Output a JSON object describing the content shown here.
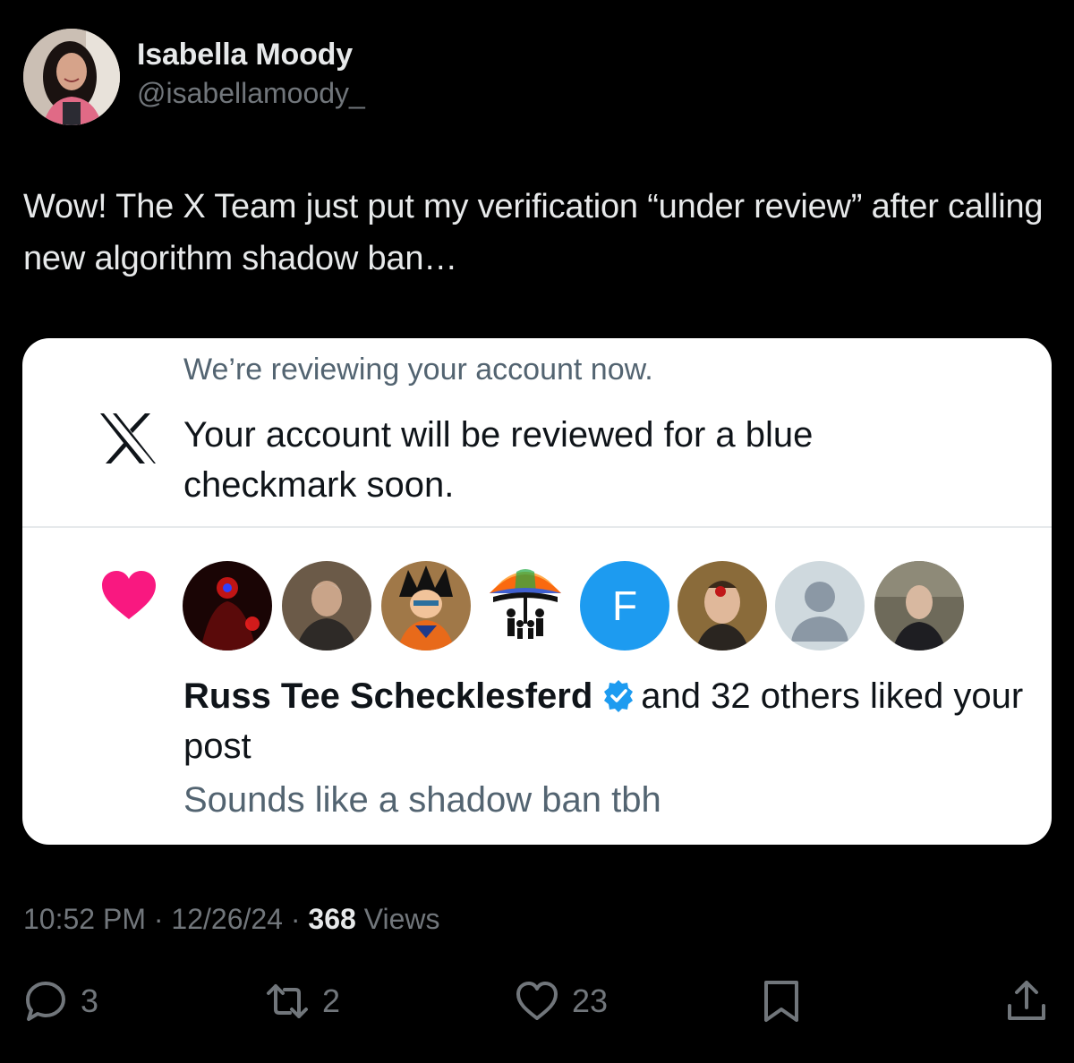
{
  "author": {
    "name": "Isabella Moody",
    "handle": "@isabellamoody_",
    "avatar_icon": "profile-photo"
  },
  "tweet": {
    "text": "Wow! The X Team just put my verification “under review” after calling new algorithm shadow ban…"
  },
  "embedded": {
    "review_title": "We’re reviewing your account now.",
    "review_body": "Your account will be reviewed for a blue checkmark soon.",
    "like_notification": {
      "liker_name": "Russ Tee Schecklesferd",
      "rest": "and 32 others liked your post",
      "reply_preview": "Sounds like a shadow ban tbh",
      "avatars": [
        {
          "icon": "dark-red-figure-avatar"
        },
        {
          "icon": "older-man-avatar"
        },
        {
          "icon": "anime-character-avatar"
        },
        {
          "icon": "umbrella-family-avatar"
        },
        {
          "icon": "letter-avatar",
          "letter": "F"
        },
        {
          "icon": "bloody-face-avatar"
        },
        {
          "icon": "default-person-avatar"
        },
        {
          "icon": "man-selfie-avatar"
        }
      ]
    },
    "colors": {
      "heart": "#f91880",
      "verified": "#1d9bf0",
      "letter_avatar": "#1d9bf0"
    }
  },
  "meta": {
    "time": "10:52 PM",
    "date": "12/26/24",
    "views_count": "368",
    "views_label": "Views"
  },
  "actions": {
    "replies": "3",
    "reposts": "2",
    "likes": "23"
  }
}
